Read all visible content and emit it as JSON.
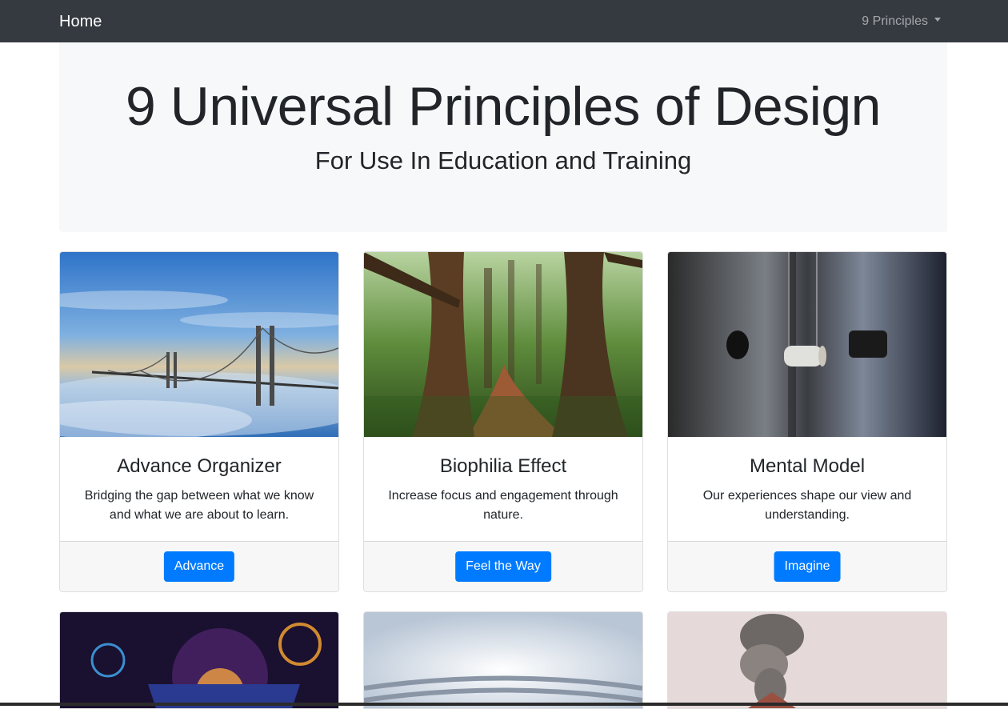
{
  "navbar": {
    "brand": "Home",
    "dropdown_label": "9 Principles"
  },
  "jumbotron": {
    "title": "9 Universal Principles of Design",
    "subtitle": "For Use In Education and Training"
  },
  "cards": [
    {
      "title": "Advance Organizer",
      "text": "Bridging the gap between what we know and what we are about to learn.",
      "button": "Advance",
      "image": "bridge-over-fog"
    },
    {
      "title": "Biophilia Effect",
      "text": "Increase focus and engagement through nature.",
      "button": "Feel the Way",
      "image": "forest-path"
    },
    {
      "title": "Mental Model",
      "text": "Our experiences shape our view and understanding.",
      "button": "Imagine",
      "image": "hanging-cork-and-holes"
    }
  ],
  "cards_row2_images": [
    "cosmic-gears",
    "bright-sky-maze",
    "volcano-smoke"
  ],
  "colors": {
    "navbar_bg": "#343a40",
    "jumbotron_bg": "#f7f8f9",
    "button_primary": "#007bff",
    "card_footer_bg": "#f7f7f7"
  }
}
